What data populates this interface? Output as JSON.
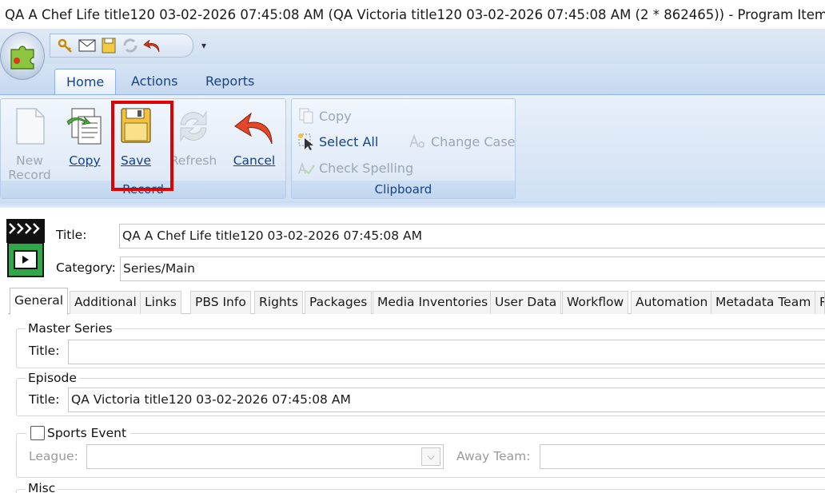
{
  "window": {
    "title": "QA A Chef Life title120 03-02-2026 07:45:08 AM (QA Victoria title120 03-02-2026 07:45:08 AM (2 * 862465)) - Program Item"
  },
  "ribbon": {
    "tabs": [
      "Home",
      "Actions",
      "Reports"
    ],
    "active_tab": "Home",
    "record_group": {
      "label": "Record",
      "buttons": {
        "new_line1": "New",
        "new_line2": "Record",
        "copy": "Copy",
        "save": "Save",
        "refresh": "Refresh",
        "cancel": "Cancel"
      }
    },
    "clipboard_group": {
      "label": "Clipboard",
      "buttons": {
        "copy": "Copy",
        "select_all": "Select All",
        "check_spelling": "Check Spelling",
        "change_case": "Change Case"
      }
    }
  },
  "form": {
    "title_label": "Title:",
    "title_value": "QA A Chef Life title120 03-02-2026 07:45:08 AM",
    "category_label": "Category:",
    "category_value": "Series/Main",
    "tabs": [
      "General",
      "Additional",
      "Links",
      "PBS Info",
      "Rights",
      "Packages",
      "Media Inventories",
      "User Data",
      "Workflow",
      "Automation",
      "Metadata Team",
      "R"
    ],
    "active_tab": "General",
    "master_series": {
      "legend": "Master Series",
      "title_label": "Title:",
      "title_value": ""
    },
    "episode": {
      "legend": "Episode",
      "title_label": "Title:",
      "title_value": "QA Victoria title120 03-02-2026 07:45:08 AM"
    },
    "sports_event": {
      "legend": "Sports Event",
      "checked": false,
      "league_label": "League:",
      "league_value": "",
      "away_team_label": "Away Team:",
      "away_team_value": ""
    },
    "misc": {
      "legend": "Misc"
    }
  },
  "colors": {
    "ribbon_text": "#15428b",
    "highlight_box": "#e00000",
    "disabled_text": "#9aa6b5"
  },
  "icons": [
    "app-puzzle-icon",
    "key-icon",
    "mail-icon",
    "save-icon",
    "refresh-icon",
    "undo-icon",
    "new-record-icon",
    "copy-icon",
    "cancel-arrow-icon",
    "select-all-icon",
    "check-spelling-icon",
    "change-case-icon",
    "program-item-icon",
    "dropdown-icon"
  ]
}
